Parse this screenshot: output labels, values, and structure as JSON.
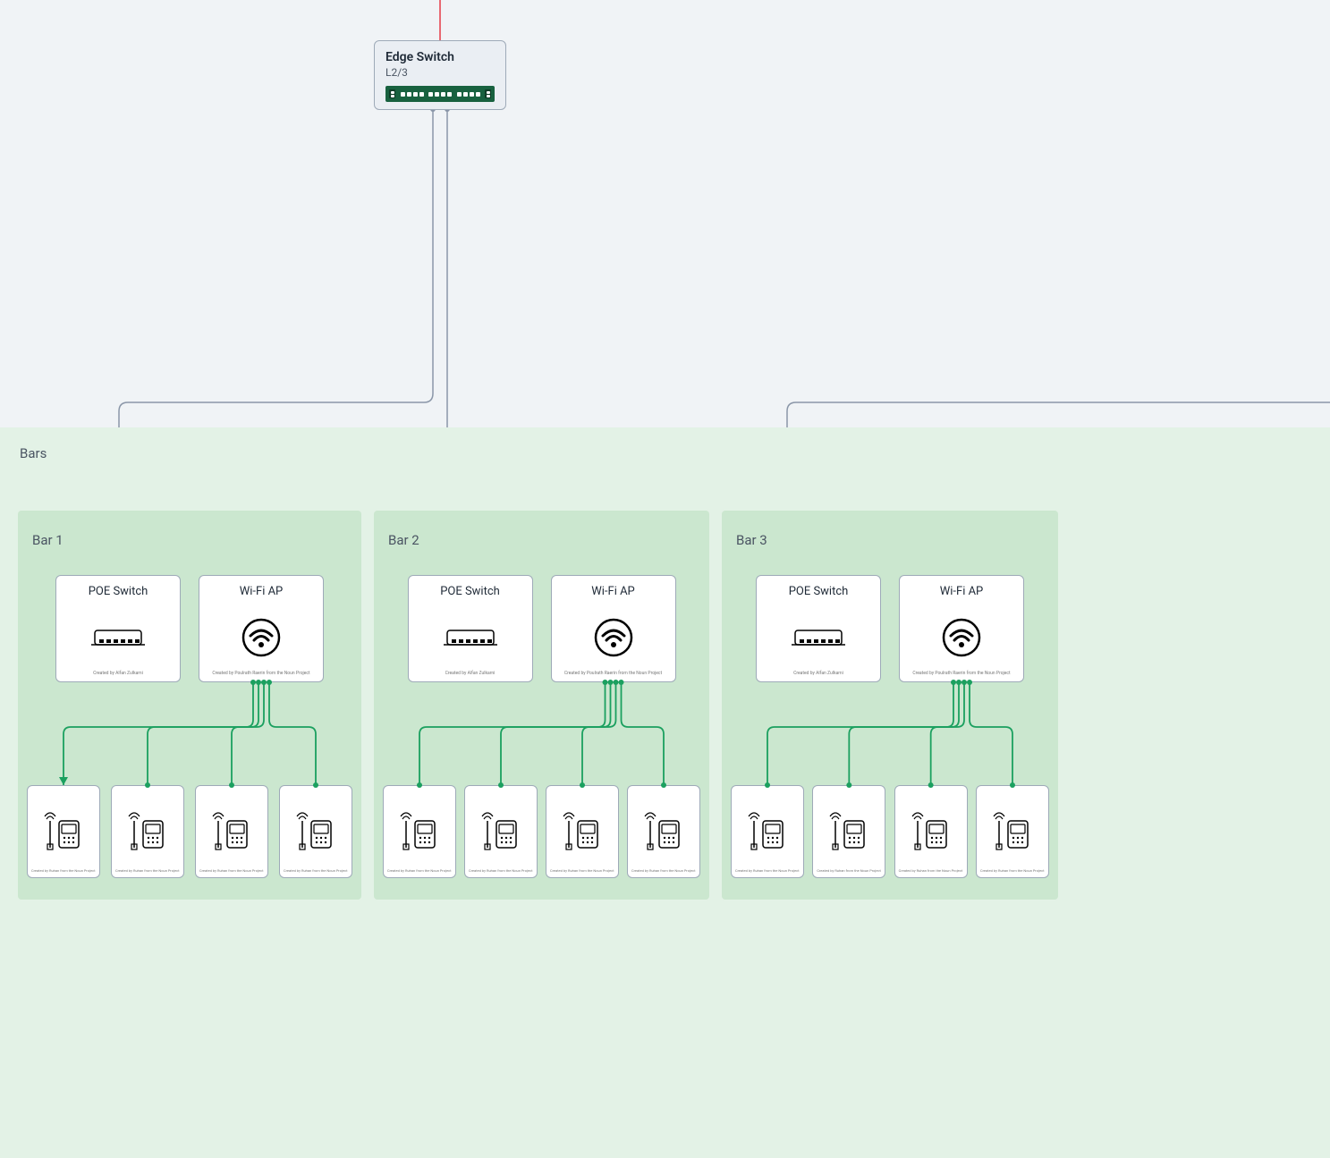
{
  "edgeSwitch": {
    "title": "Edge Switch",
    "subtitle": "L2/3"
  },
  "barsGroup": {
    "label": "Bars"
  },
  "bars": [
    {
      "label": "Bar 1",
      "poe": {
        "title": "POE Switch",
        "credit": "Created by Alfan Zulkarni"
      },
      "wifi": {
        "title": "Wi-Fi AP",
        "credit": "Created by Poulrath Raerin from the Noun Project"
      },
      "pos": [
        {
          "credit": "Created by Ruhan from the Noun Project"
        },
        {
          "credit": "Created by Ruhan from the Noun Project"
        },
        {
          "credit": "Created by Ruhan from the Noun Project"
        },
        {
          "credit": "Created by Ruhan from the Noun Project"
        }
      ]
    },
    {
      "label": "Bar 2",
      "poe": {
        "title": "POE Switch",
        "credit": "Created by Alfan Zulkarni"
      },
      "wifi": {
        "title": "Wi-Fi AP",
        "credit": "Created by Poulrath Raerin from the Noun Project"
      },
      "pos": [
        {
          "credit": "Created by Ruhan from the Noun Project"
        },
        {
          "credit": "Created by Ruhan from the Noun Project"
        },
        {
          "credit": "Created by Ruhan from the Noun Project"
        },
        {
          "credit": "Created by Ruhan from the Noun Project"
        }
      ]
    },
    {
      "label": "Bar 3",
      "poe": {
        "title": "POE Switch",
        "credit": "Created by Alfan Zulkarni"
      },
      "wifi": {
        "title": "Wi-Fi AP",
        "credit": "Created by Poulrath Raerin from the Noun Project"
      },
      "pos": [
        {
          "credit": "Created by Ruhan from the Noun Project"
        },
        {
          "credit": "Created by Ruhan from the Noun Project"
        },
        {
          "credit": "Created by Ruhan from the Noun Project"
        },
        {
          "credit": "Created by Ruhan from the Noun Project"
        }
      ]
    }
  ],
  "icons": {
    "poe": "network-switch-icon",
    "wifi": "wifi-ap-icon",
    "pos": "pos-terminal-icon"
  }
}
